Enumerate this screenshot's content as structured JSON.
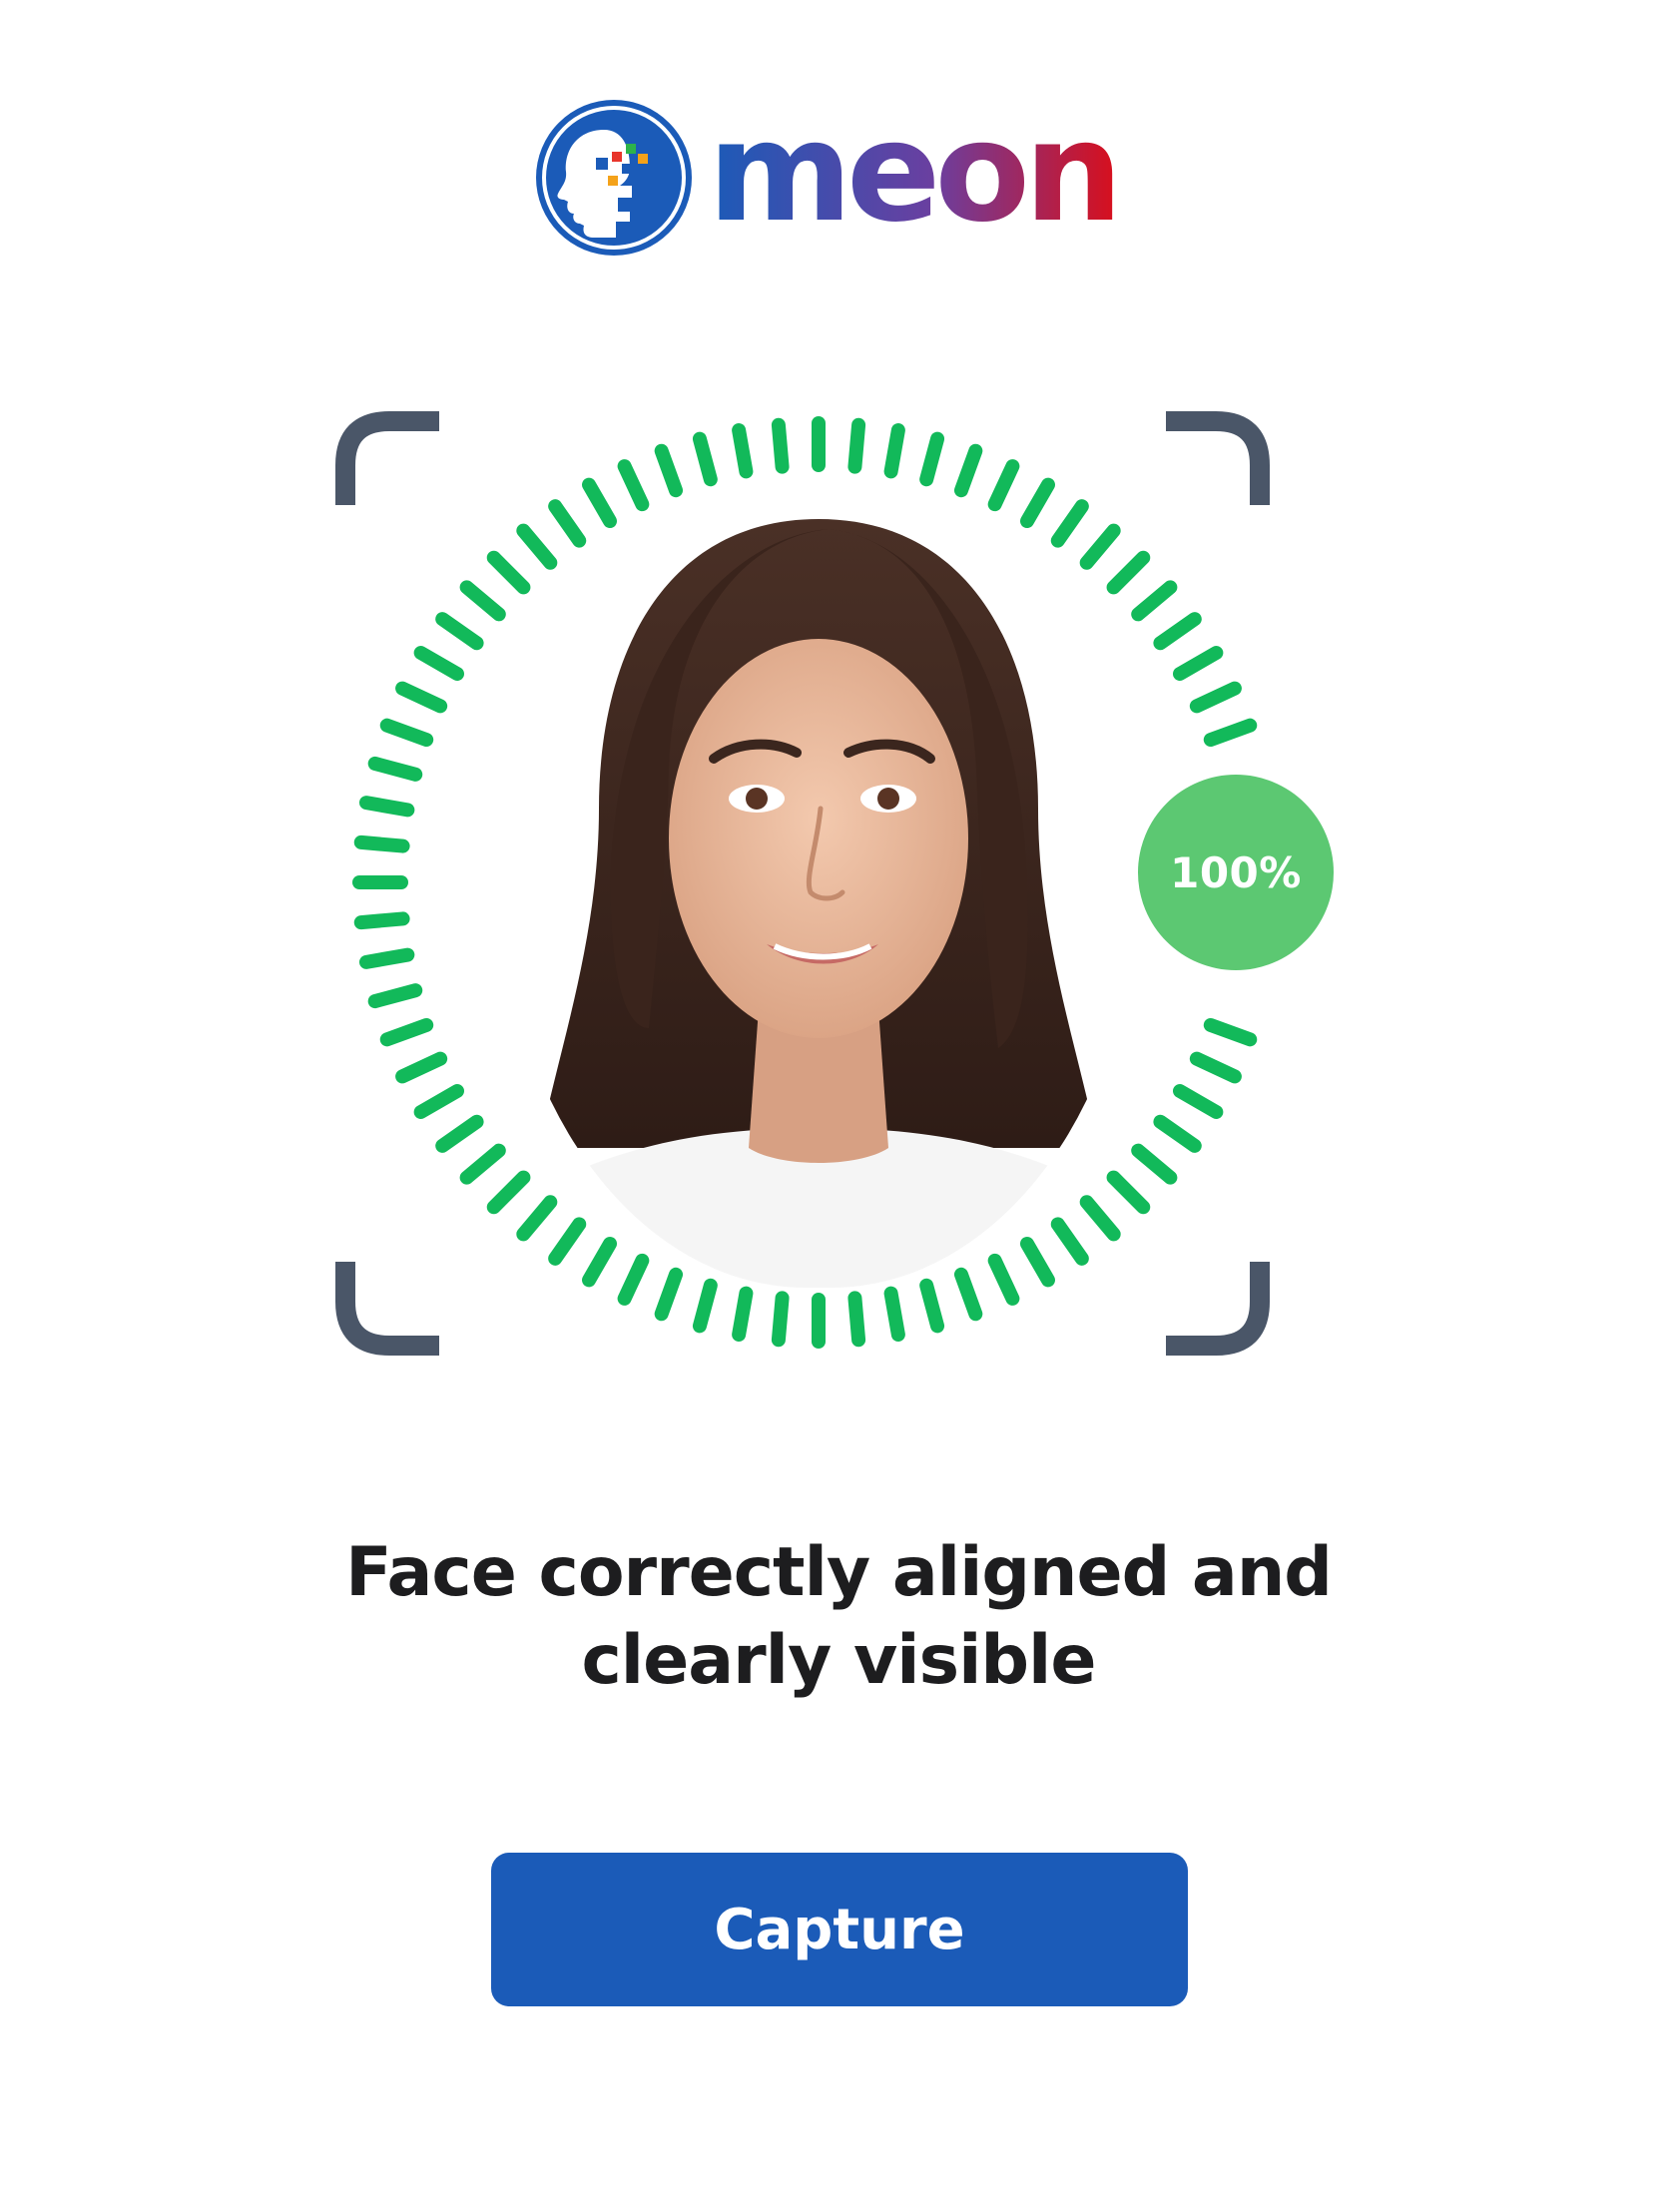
{
  "brand": {
    "name": "MEON",
    "logo_icon": "head-profile-icon",
    "colors": {
      "blue": "#1b5bb8",
      "purple": "#6a3fa0",
      "red": "#d80f1c"
    }
  },
  "scanner": {
    "progress_label": "100%",
    "progress": 1.0,
    "ring_color": "#12b95a",
    "badge_color": "#5cc872",
    "corner_color": "#4a5668"
  },
  "instruction": {
    "line1": "Face correctly aligned and",
    "line2": "clearly visible"
  },
  "actions": {
    "capture_label": "Capture"
  }
}
